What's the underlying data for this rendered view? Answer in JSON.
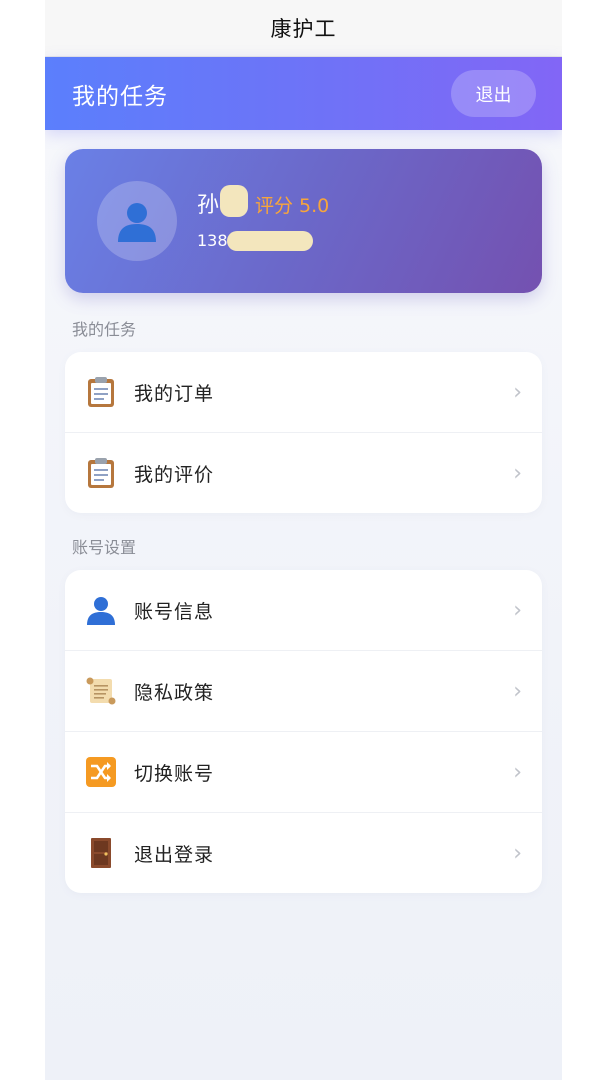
{
  "app": {
    "title": "康护工"
  },
  "header": {
    "title": "我的任务",
    "logout_label": "退出"
  },
  "profile": {
    "name": "孙",
    "rating": "评分 5.0",
    "phone": "138",
    "colors": {
      "rating": "#f7a53b"
    }
  },
  "tasks_section": {
    "label": "我的任务",
    "items": [
      {
        "label": "我的订单",
        "icon": "clipboard-icon"
      },
      {
        "label": "我的评价",
        "icon": "clipboard-icon"
      }
    ]
  },
  "account_section": {
    "label": "账号设置",
    "items": [
      {
        "label": "账号信息",
        "icon": "user-icon"
      },
      {
        "label": "隐私政策",
        "icon": "scroll-icon"
      },
      {
        "label": "切换账号",
        "icon": "shuffle-icon"
      },
      {
        "label": "退出登录",
        "icon": "door-icon"
      }
    ]
  },
  "chevron": "›",
  "colors": {
    "header_gradient_start": "#5b7ffc",
    "header_gradient_end": "#8266f6",
    "card_gradient_start": "#6a80e6",
    "card_gradient_end": "#7451b0"
  }
}
